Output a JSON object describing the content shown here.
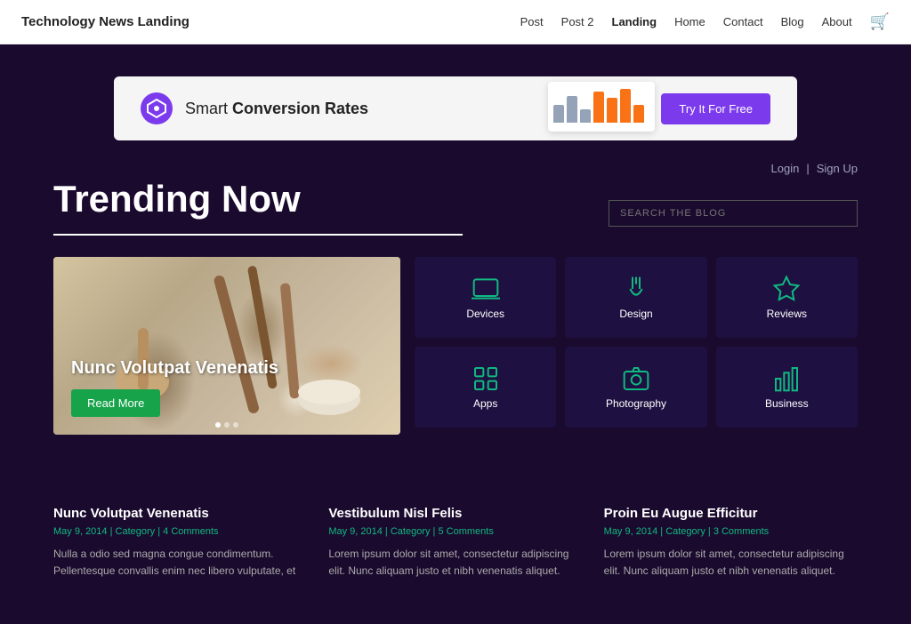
{
  "nav": {
    "brand": "Technology News Landing",
    "links": [
      {
        "label": "Post",
        "href": "#",
        "active": false
      },
      {
        "label": "Post 2",
        "href": "#",
        "active": false
      },
      {
        "label": "Landing",
        "href": "#",
        "active": true
      },
      {
        "label": "Home",
        "href": "#",
        "active": false
      },
      {
        "label": "Contact",
        "href": "#",
        "active": false
      },
      {
        "label": "Blog",
        "href": "#",
        "active": false
      },
      {
        "label": "About",
        "href": "#",
        "active": false
      }
    ]
  },
  "banner": {
    "logo_symbol": "⬡",
    "brand_name": "Smart ",
    "brand_highlight": "Conversion Rates",
    "cta_label": "Try It For Free"
  },
  "auth": {
    "login": "Login",
    "separator": "|",
    "signup": "Sign Up"
  },
  "trending": {
    "title": "Trending Now",
    "search_placeholder": "SEARCH THE BLOG",
    "featured": {
      "title": "Nunc Volutpat Venenatis",
      "read_more": "Read More"
    },
    "categories": [
      {
        "id": "devices",
        "label": "Devices"
      },
      {
        "id": "design",
        "label": "Design"
      },
      {
        "id": "reviews",
        "label": "Reviews"
      },
      {
        "id": "apps",
        "label": "Apps"
      },
      {
        "id": "photography",
        "label": "Photography"
      },
      {
        "id": "business",
        "label": "Business"
      }
    ]
  },
  "blog_posts": [
    {
      "title": "Nunc Volutpat Venenatis",
      "date": "May 9, 2014",
      "category": "Category",
      "comments": "4 Comments",
      "excerpt": "Nulla a odio sed magna congue condimentum. Pellentesque convallis enim nec libero vulputate, et"
    },
    {
      "title": "Vestibulum Nisl Felis",
      "date": "May 9, 2014",
      "category": "Category",
      "comments": "5 Comments",
      "excerpt": "Lorem ipsum dolor sit amet, consectetur adipiscing elit. Nunc aliquam justo et nibh venenatis aliquet."
    },
    {
      "title": "Proin Eu Augue Efficitur",
      "date": "May 9, 2014",
      "category": "Category",
      "comments": "3 Comments",
      "excerpt": "Lorem ipsum dolor sit amet, consectetur adipiscing elit. Nunc aliquam justo et nibh venenatis aliquet."
    }
  ]
}
